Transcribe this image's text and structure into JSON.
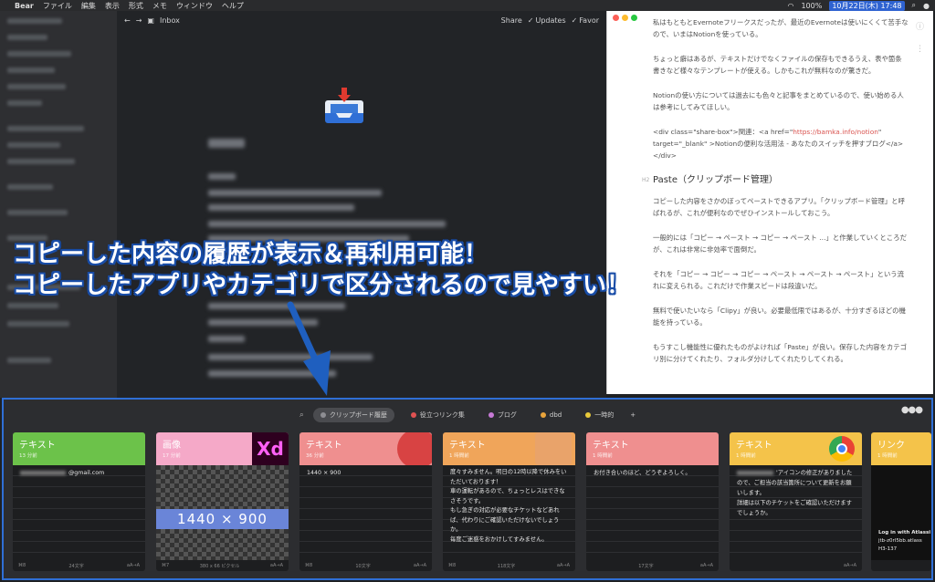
{
  "menubar": {
    "app": "Bear",
    "items": [
      "ファイル",
      "編集",
      "表示",
      "形式",
      "メモ",
      "ウィンドウ",
      "ヘルプ"
    ],
    "battery": "100%",
    "datetime": "10月22日(木) 17:48"
  },
  "bear": {
    "folder": "Inbox",
    "share": "Share",
    "updates": "Updates",
    "favorites": "Favor"
  },
  "note": {
    "p1": "私はもともとEvernoteフリークスだったが、最近のEvernoteは使いにくくて苦手なので、いまはNotionを使っている。",
    "p2": "ちょっと癖はあるが、テキストだけでなくファイルの保存もできるうえ、表や箇条書きなど様々なテンプレートが使える。しかもこれが無料なのが驚きだ。",
    "p3": "Notionの使い方については過去にも色々と記事をまとめているので、使い始める人は参考にしてみてほしい。",
    "code_pre": "<div class=\"share-box\">関連：<a href=\"",
    "code_link": "https://bamka.info/notion",
    "code_post": "\" target=\"_blank\" >Notionの便利な活用法 - あなたのスイッチを押すブログ</a></div>",
    "heading_level": "H2",
    "heading": "Paste（クリップボード管理）",
    "p4": "コピーした内容をさかのぼってペーストできるアプリ。「クリップボード管理」と呼ばれるが、これが便利なのでぜひインストールしておこう。",
    "p5": "一般的には「コピー → ペースト → コピー → ペースト …」と作業していくところだが、これは非常に非効率で面倒だ。",
    "p6": "それを「コピー → コピー → コピー → ペースト → ペースト → ペースト」という流れに変えられる。これだけで作業スピードは段違いだ。",
    "p7": "無料で使いたいなら「Clipy」が良い。必要最低限ではあるが、十分すぎるほどの機能を持っている。",
    "p8": "もうすこし機能性に優れたものがよければ「Paste」が良い。保存した内容をカテゴリ別に分けてくれたり、フォルダ分けしてくれたりしてくれる。"
  },
  "overlay": {
    "line1": "コピーした内容の履歴が表示＆再利用可能！",
    "line2": "コピーしたアプリやカテゴリで区分されるので見やすい！"
  },
  "paste": {
    "tabs": [
      {
        "label": "クリップボード履歴",
        "color": "#8e8e93"
      },
      {
        "label": "役立つリンク集",
        "color": "#e05252"
      },
      {
        "label": "ブログ",
        "color": "#c77ad6"
      },
      {
        "label": "dbd",
        "color": "#e9a43b"
      },
      {
        "label": "一時的",
        "color": "#e8c93a"
      }
    ],
    "add": "+",
    "cards": [
      {
        "type": "テキスト",
        "meta": "13 分前",
        "color": "#6cc24a",
        "lines": [
          "@gmail.com"
        ],
        "foot_left": "⌘8",
        "foot_mid": "24文字",
        "foot_right": "aA→A"
      },
      {
        "type": "画像",
        "meta": "17 分前",
        "color": "#f5a9c8",
        "image_label": "1440 × 900",
        "foot_left": "⌘7",
        "foot_mid": "380 x 66 ピクセル",
        "foot_right": "aA→A"
      },
      {
        "type": "テキスト",
        "meta": "36 分前",
        "color": "#ef8f8f",
        "lines": [
          "1440 × 900"
        ],
        "foot_left": "⌘8",
        "foot_mid": "10文字",
        "foot_right": "aA→A"
      },
      {
        "type": "テキスト",
        "meta": "1 時間前",
        "color": "#f0a55a",
        "lines": [
          "度々すみません。明日の12時以降で休みをいただいております！",
          "車の運転があるので、ちょっとレスはできなさそうです。",
          "もし急ぎの対応が必要なチケットなどあれば、代わりにご確認いただけないでしょうか。",
          "毎度ご迷惑をおかけしてすみません。"
        ],
        "foot_left": "⌘8",
        "foot_mid": "118文字",
        "foot_right": "aA→A"
      },
      {
        "type": "テキスト",
        "meta": "1 時間前",
        "color": "#ef8f8f",
        "lines": [
          "お付き合いのほど、どうぞよろしく。"
        ],
        "foot_left": "",
        "foot_mid": "17文字",
        "foot_right": "aA→A"
      },
      {
        "type": "テキスト",
        "meta": "1 時間前",
        "color": "#f4c34a",
        "lines": [
          "'アイコンの修正がありましたので、ご担当の該当箇所について更新をお願いします。",
          "",
          "詳細は以下のチケットをご確認いただけますでしょうか。"
        ],
        "foot_left": "",
        "foot_mid": "",
        "foot_right": "aA→A"
      },
      {
        "type": "リンク",
        "meta": "1 時間前",
        "color": "#f4c34a",
        "lines": [
          "Log in with Atlassi",
          "jtb-z0rl5bb.atlass",
          "H3-137"
        ],
        "foot_left": "",
        "foot_mid": "",
        "foot_right": ""
      }
    ]
  }
}
